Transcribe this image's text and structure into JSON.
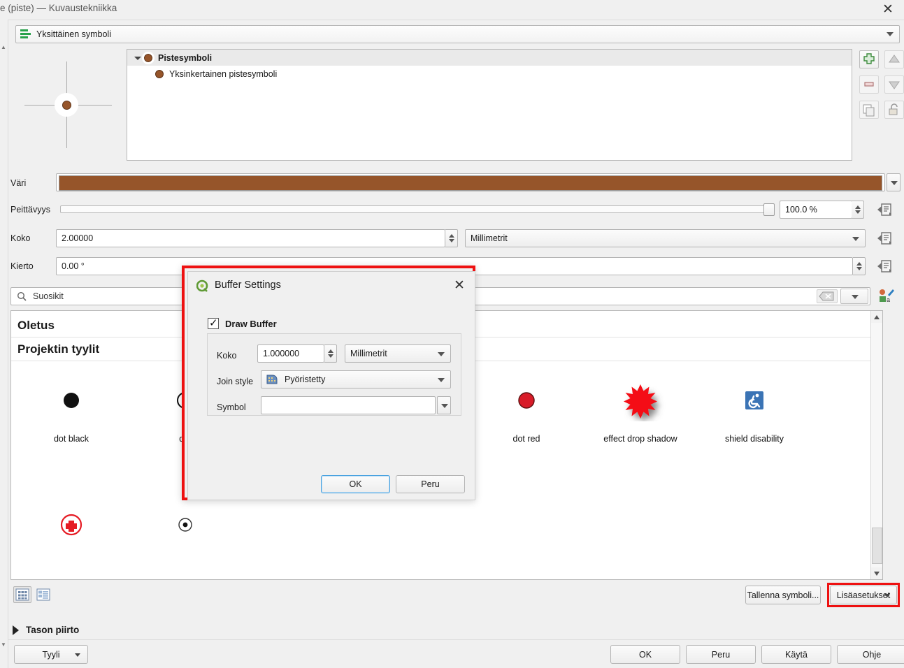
{
  "window": {
    "title": "e (piste) — Kuvaustekniikka",
    "close_icon": "close-icon"
  },
  "renderer": {
    "label": "Yksittäinen symboli",
    "icon": "layers-icon"
  },
  "symbol_tree": {
    "items": [
      {
        "label": "Pistesymboli",
        "level": 0
      },
      {
        "label": "Yksinkertainen pistesymboli",
        "level": 1
      }
    ]
  },
  "layer_toolbar": {
    "add": "add-symbol-layer-button",
    "remove": "remove-symbol-layer-button",
    "duplicate": "duplicate-symbol-layer-button",
    "move_up": "move-up-button",
    "move_down": "move-down-button",
    "lock": "lock-layer-button"
  },
  "properties": {
    "color": {
      "label": "Väri",
      "value": "#96552a"
    },
    "opacity": {
      "label": "Peittävyys",
      "value": "100.0 %"
    },
    "size": {
      "label": "Koko",
      "value": "2.00000",
      "unit": "Millimetrit"
    },
    "rotation": {
      "label": "Kierto",
      "value": "0.00 °"
    }
  },
  "search": {
    "placeholder": "Suosikit",
    "value": "Suosikit",
    "icon": "search-icon",
    "clear_icon": "clear-icon"
  },
  "gallery": {
    "groups": [
      {
        "title": "Oletus"
      },
      {
        "title": "Projektin tyylit"
      }
    ],
    "items": [
      {
        "caption": "dot  black",
        "glyph": "dot-black"
      },
      {
        "caption": "dot",
        "glyph": "dot-outline"
      },
      {
        "caption": "dot red",
        "glyph": "dot-red"
      },
      {
        "caption": "effect drop shadow",
        "glyph": "star-drop-shadow"
      },
      {
        "caption": "shield disability",
        "glyph": "shield-disability"
      },
      {
        "caption": "",
        "glyph": "red-cross-circle"
      },
      {
        "caption": "",
        "glyph": "dot-ring"
      }
    ]
  },
  "view_toggle": {
    "grid": "grid-view-button",
    "list": "list-view-button"
  },
  "actions": {
    "save_symbol": "Tallenna symboli...",
    "advanced": "Lisäasetukset"
  },
  "layer_rendering": {
    "label": "Tason piirto"
  },
  "footer": {
    "style_menu": "Tyyli",
    "ok": "OK",
    "cancel": "Peru",
    "apply": "Käytä",
    "help": "Ohje"
  },
  "buffer_dialog": {
    "title": "Buffer Settings",
    "draw_buffer": "Draw Buffer",
    "size_label": "Koko",
    "size_value": "1.000000",
    "size_unit": "Millimetrit",
    "join_style_label": "Join style",
    "join_style_value": "Pyöristetty",
    "symbol_label": "Symbol",
    "symbol_value": "",
    "ok": "OK",
    "cancel": "Peru"
  },
  "colors": {
    "brown": "#96552a",
    "highlight_red": "#ee1111",
    "accent_green": "#27a14a",
    "focus_blue": "#4aa3e0"
  }
}
